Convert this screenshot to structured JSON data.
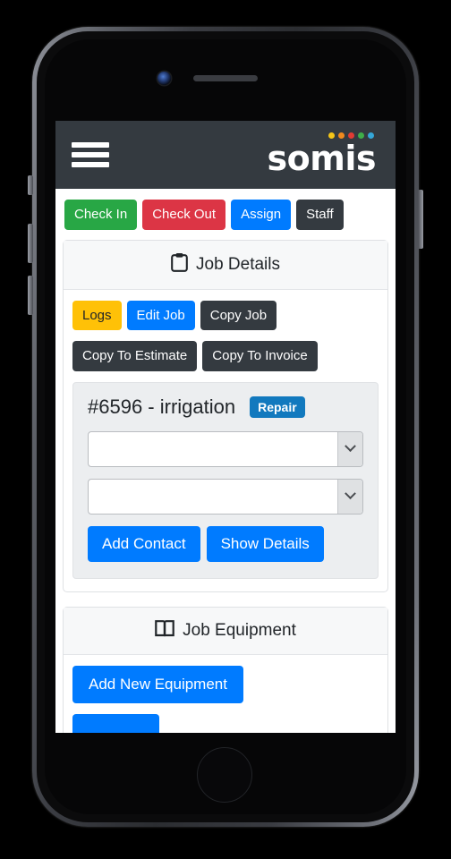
{
  "device": {
    "type": "smartphone-mockup",
    "camera_icon": "camera-icon",
    "speaker_icon": "speaker-grille-icon",
    "home_button_icon": "home-button-icon"
  },
  "navbar": {
    "menu_icon": "hamburger-menu-icon",
    "logo_text": "somis",
    "logo_dot_colors": [
      "#f5c518",
      "#f08a1e",
      "#e23b34",
      "#3fae49",
      "#35a7d8"
    ]
  },
  "toolbar": {
    "buttons": [
      {
        "label": "Check In",
        "style": "success",
        "name": "check-in-button"
      },
      {
        "label": "Check Out",
        "style": "danger",
        "name": "check-out-button"
      },
      {
        "label": "Assign",
        "style": "primary",
        "name": "assign-button"
      },
      {
        "label": "Staff",
        "style": "dark",
        "name": "staff-button"
      }
    ]
  },
  "job_details": {
    "header_icon": "clipboard-icon",
    "header_title": "Job Details",
    "actions_row1": [
      {
        "label": "Logs",
        "style": "warning",
        "name": "logs-button"
      },
      {
        "label": "Edit Job",
        "style": "primary",
        "name": "edit-job-button"
      },
      {
        "label": "Copy Job",
        "style": "dark",
        "name": "copy-job-button"
      }
    ],
    "actions_row2": [
      {
        "label": "Copy To Estimate",
        "style": "dark",
        "name": "copy-to-estimate-button"
      },
      {
        "label": "Copy To Invoice",
        "style": "dark",
        "name": "copy-to-invoice-button"
      }
    ],
    "job_title": "#6596 - irrigation",
    "job_badge": "Repair",
    "badge_color": "#1279be",
    "select_1": {
      "value": "",
      "placeholder": ""
    },
    "select_2": {
      "value": "",
      "placeholder": ""
    },
    "dropdown_icon": "chevron-down-icon",
    "panel_buttons": [
      {
        "label": "Add Contact",
        "style": "primary",
        "name": "add-contact-button"
      },
      {
        "label": "Show Details",
        "style": "primary",
        "name": "show-details-button"
      }
    ]
  },
  "job_equipment": {
    "header_icon": "open-book-icon",
    "header_title": "Job Equipment",
    "add_new_label": "Add New Equipment",
    "secondary_label": ""
  },
  "colors": {
    "navbar_bg": "#343a40",
    "success": "#28a745",
    "danger": "#dc3545",
    "primary": "#007bff",
    "dark": "#343a40",
    "warning": "#ffc107",
    "panel_bg": "#eceef0"
  }
}
